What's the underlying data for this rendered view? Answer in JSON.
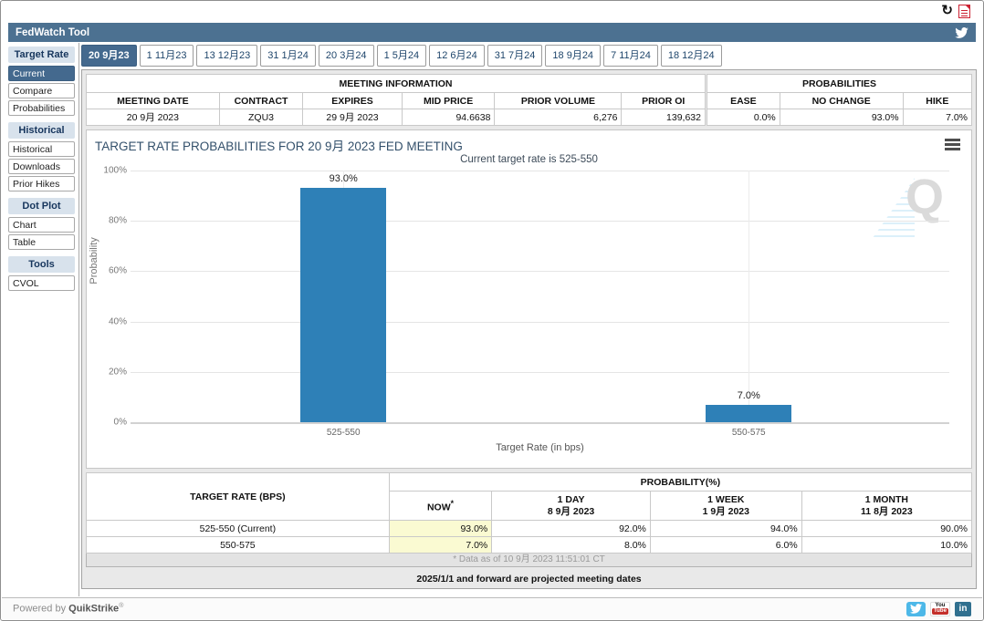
{
  "window": {
    "title": "FedWatch Tool"
  },
  "sidebar": {
    "sections": [
      {
        "header": "Target Rate",
        "items": [
          "Current",
          "Compare",
          "Probabilities"
        ],
        "selected": "Current"
      },
      {
        "header": "Historical",
        "items": [
          "Historical",
          "Downloads",
          "Prior Hikes"
        ]
      },
      {
        "header": "Dot Plot",
        "items": [
          "Chart",
          "Table"
        ]
      },
      {
        "header": "Tools",
        "items": [
          "CVOL"
        ]
      }
    ]
  },
  "tabs": [
    "20 9月23",
    "1 11月23",
    "13 12月23",
    "31 1月24",
    "20 3月24",
    "1 5月24",
    "12 6月24",
    "31 7月24",
    "18 9月24",
    "7 11月24",
    "18 12月24"
  ],
  "selected_tab": "20 9月23",
  "meeting_information": {
    "title": "MEETING INFORMATION",
    "columns": [
      "MEETING DATE",
      "CONTRACT",
      "EXPIRES",
      "MID PRICE",
      "PRIOR VOLUME",
      "PRIOR OI"
    ],
    "values": [
      "20 9月 2023",
      "ZQU3",
      "29 9月 2023",
      "94.6638",
      "6,276",
      "139,632"
    ]
  },
  "probabilities": {
    "title": "PROBABILITIES",
    "columns": [
      "EASE",
      "NO CHANGE",
      "HIKE"
    ],
    "values": [
      "0.0%",
      "93.0%",
      "7.0%"
    ]
  },
  "chart_data": {
    "type": "bar",
    "title": "TARGET RATE PROBABILITIES FOR 20 9月 2023 FED MEETING",
    "subtitle": "Current target rate is 525-550",
    "categories": [
      "525-550",
      "550-575"
    ],
    "values": [
      93.0,
      7.0
    ],
    "value_labels": [
      "93.0%",
      "7.0%"
    ],
    "xlabel": "Target Rate (in bps)",
    "ylabel": "Probability",
    "ylim": [
      0,
      100
    ],
    "yticks": [
      "100%",
      "80%",
      "60%",
      "40%",
      "20%",
      "0%"
    ],
    "grid": true,
    "legend": "none",
    "bar_color": "#2e80b7"
  },
  "history_table": {
    "rate_header": "TARGET RATE (BPS)",
    "group_header": "PROBABILITY(%)",
    "subcols": [
      {
        "line1": "NOW",
        "sup": "*",
        "line2": ""
      },
      {
        "line1": "1 DAY",
        "line2": "8 9月 2023"
      },
      {
        "line1": "1 WEEK",
        "line2": "1 9月 2023"
      },
      {
        "line1": "1 MONTH",
        "line2": "11 8月 2023"
      }
    ],
    "rows": [
      {
        "rate": "525-550 (Current)",
        "now": "93.0%",
        "day": "92.0%",
        "week": "94.0%",
        "month": "90.0%"
      },
      {
        "rate": "550-575",
        "now": "7.0%",
        "day": "8.0%",
        "week": "6.0%",
        "month": "10.0%"
      }
    ],
    "footnote": "* Data as of 10 9月 2023 11:51:01 CT",
    "projection_note": "2025/1/1 and forward are projected meeting dates"
  },
  "footer": {
    "powered_by": "Powered by ",
    "brand": "QuikStrike",
    "registered": "®",
    "youtube_top": "You",
    "youtube_bottom": "Tube",
    "linkedin_label": "in"
  },
  "colors": {
    "header_bar": "#4c7191",
    "selected": "#44698e",
    "bar": "#2e80b7",
    "now_highlight": "#fafad2"
  }
}
